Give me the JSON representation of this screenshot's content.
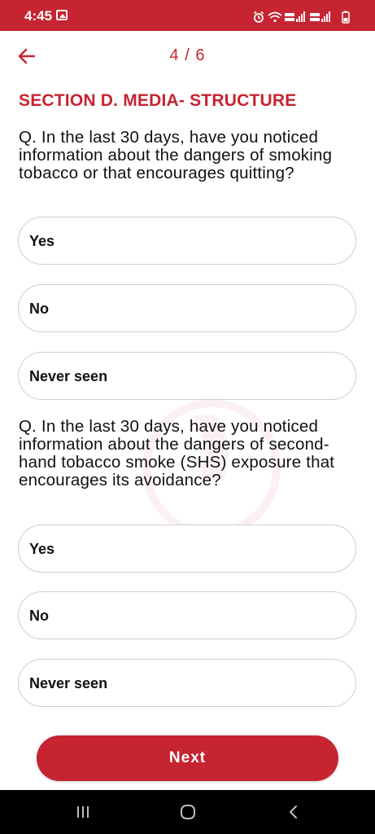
{
  "status_bar": {
    "time": "4:45",
    "icons": [
      "image-icon",
      "alarm-icon",
      "wifi-icon",
      "signal-lte1-icon",
      "signal-lte2-icon",
      "battery-icon"
    ]
  },
  "header": {
    "back_icon": "arrow-left-icon",
    "progress": "4 / 6"
  },
  "section": {
    "title": "SECTION D. MEDIA- STRUCTURE"
  },
  "questions": [
    {
      "text": "Q. In the last 30 days, have you noticed information about the dangers of smoking tobacco or that encourages quitting?",
      "options": [
        "Yes",
        "No",
        "Never seen"
      ]
    },
    {
      "text": "Q. In the last 30 days, have you noticed information about the dangers of second-hand tobacco smoke (SHS) exposure that encourages its avoidance?",
      "options": [
        "Yes",
        "No",
        "Never seen"
      ]
    }
  ],
  "footer": {
    "next_label": "Next"
  },
  "nav": {
    "icons": [
      "recents-icon",
      "home-icon",
      "back-icon"
    ]
  },
  "colors": {
    "brand": "#c62431",
    "text": "#111111",
    "border": "#cfcfcf",
    "nav_bg": "#000000"
  }
}
